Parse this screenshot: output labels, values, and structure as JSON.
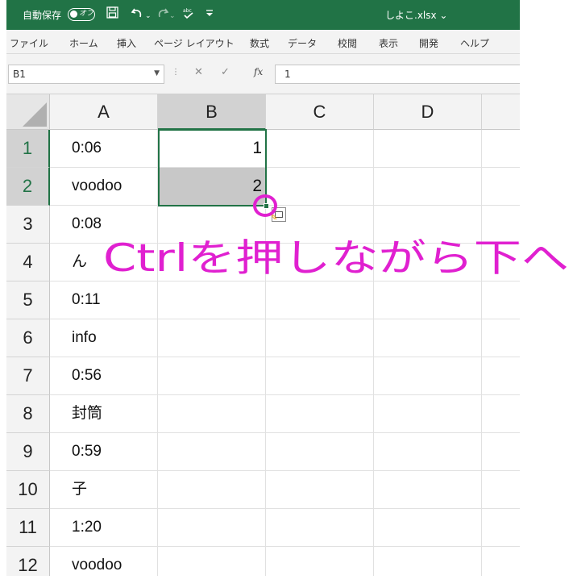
{
  "titlebar": {
    "autosave_label": "自動保存",
    "autosave_toggle": "オフ",
    "save_icon": "save-icon",
    "undo_icon": "undo-icon",
    "redo_icon": "redo-icon",
    "spelling_icon": "spelling-icon",
    "customize_icon": "customize-qat-icon",
    "filename": "しよこ.xlsx ⌄"
  },
  "ribbon": {
    "tabs": [
      "ファイル",
      "ホーム",
      "挿入",
      "ページ レイアウト",
      "数式",
      "データ",
      "校閲",
      "表示",
      "開発",
      "ヘルプ"
    ]
  },
  "formula_bar": {
    "name_box": "B1",
    "formula": "1"
  },
  "columns": [
    "A",
    "B",
    "C",
    "D"
  ],
  "rows": [
    {
      "num": "1",
      "a": "0:06",
      "b": "1"
    },
    {
      "num": "2",
      "a": "voodoo",
      "b": "2"
    },
    {
      "num": "3",
      "a": "0:08",
      "b": ""
    },
    {
      "num": "4",
      "a": "ん",
      "b": ""
    },
    {
      "num": "5",
      "a": "0:11",
      "b": ""
    },
    {
      "num": "6",
      "a": "info",
      "b": ""
    },
    {
      "num": "7",
      "a": "0:56",
      "b": ""
    },
    {
      "num": "8",
      "a": "封筒",
      "b": ""
    },
    {
      "num": "9",
      "a": "0:59",
      "b": ""
    },
    {
      "num": "10",
      "a": "子",
      "b": ""
    },
    {
      "num": "11",
      "a": "1:20",
      "b": ""
    },
    {
      "num": "12",
      "a": "voodoo",
      "b": ""
    }
  ],
  "selection": {
    "range": "B1:B2"
  },
  "annotation": {
    "text": "Ctrlを押しながら下へ",
    "color": "#e020d0"
  },
  "colors": {
    "excel_green": "#217346",
    "selected_header": "#d2d2d2"
  }
}
